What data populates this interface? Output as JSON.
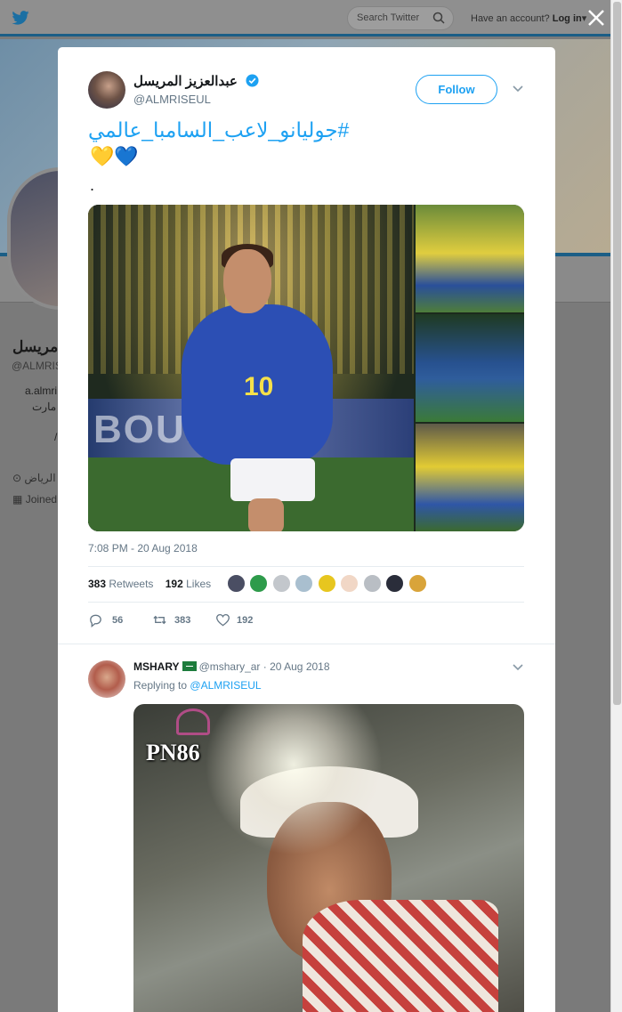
{
  "topbar": {
    "search_placeholder": "Search Twitter",
    "account_prompt": "Have an account?",
    "login_label": "Log in"
  },
  "profile_bg": {
    "name_partial": "مريسل",
    "handle_partial": "@ALMRIS",
    "bio_line1": "a.almri",
    "bio_line2": "مارت",
    "bio_line3": "/",
    "location_partial": "الرياض",
    "joined_partial": "Joined"
  },
  "tweet": {
    "author_name": "عبدالعزيز المريسل",
    "author_handle": "@ALMRISEUL",
    "follow_label": "Follow",
    "text_hashtag": "#جوليانو_لاعب_السامبا_عالمي",
    "text_emojis": "💛💙",
    "text_dot": ".",
    "timestamp": "7:08 PM - 20 Aug 2018",
    "retweets_count": "383",
    "retweets_label": "Retweets",
    "likes_count": "192",
    "likes_label": "Likes",
    "reply_count": "56",
    "retweet_count_action": "383",
    "like_count_action": "192",
    "image_banner_text": "BOUR",
    "image_jersey_number": "10"
  },
  "reply": {
    "author_name": "MSHARY",
    "author_handle": "@mshary_ar",
    "date": "· 20 Aug 2018",
    "replying_prefix": "Replying to",
    "replying_to": "@ALMRISEUL",
    "media_watermark": "PN86"
  },
  "colors": {
    "accent": "#1da1f2",
    "text_primary": "#14171a",
    "text_secondary": "#657786",
    "overlay": "#7a7a7a"
  }
}
